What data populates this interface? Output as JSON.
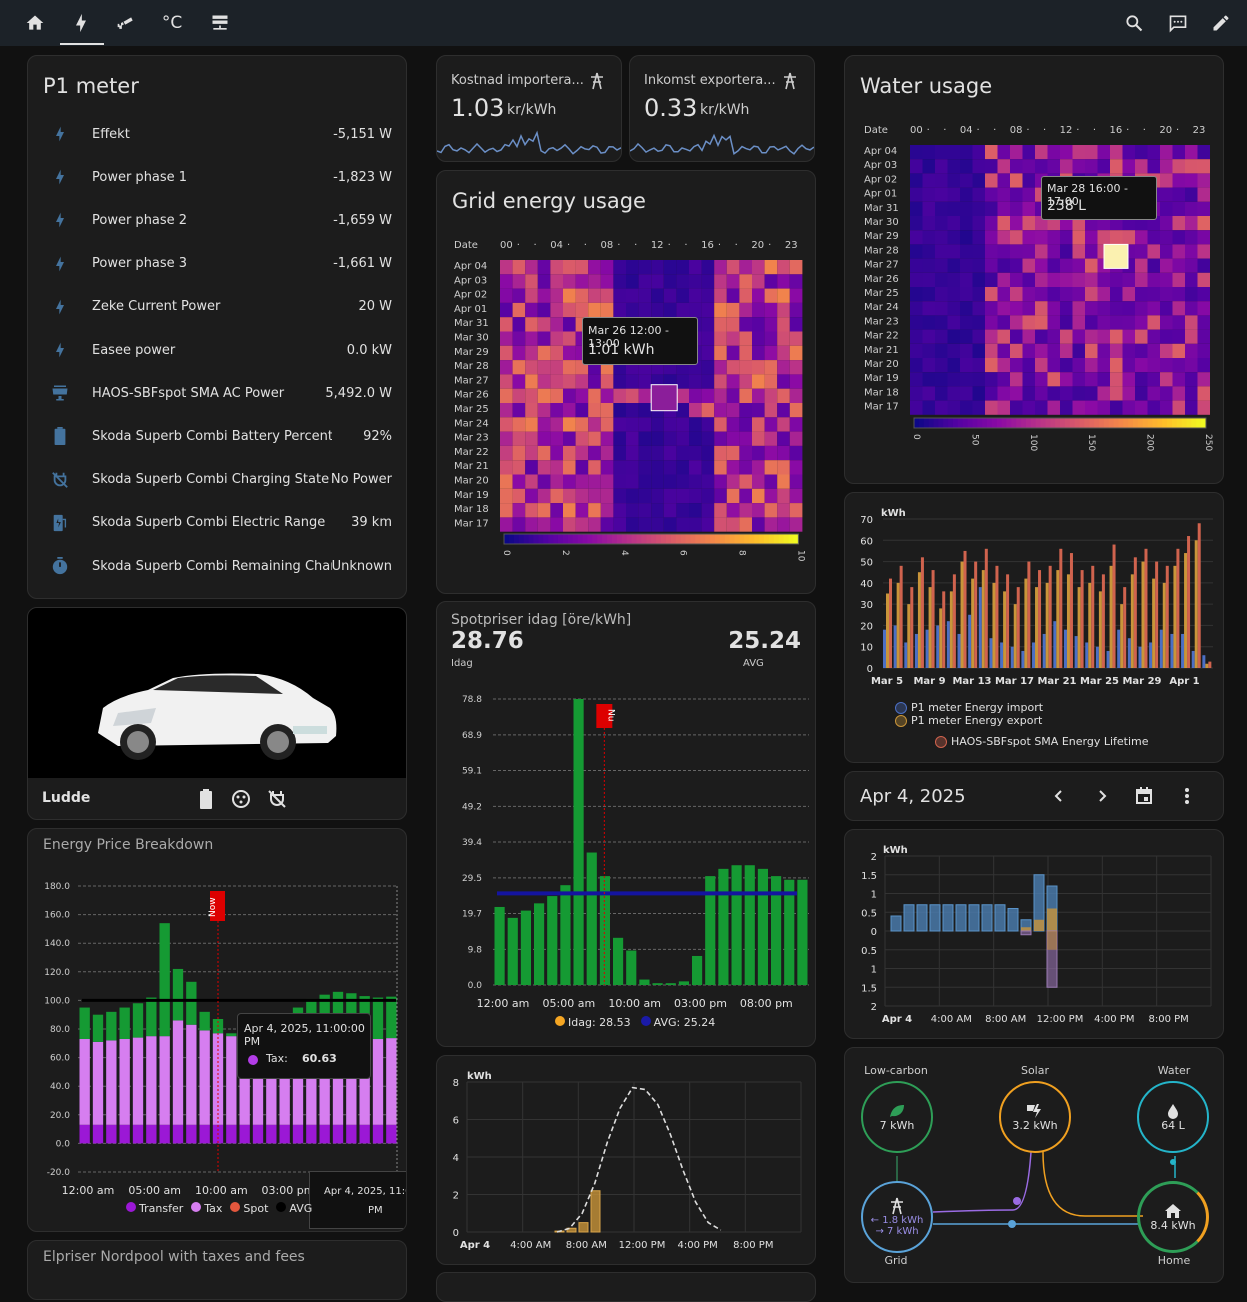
{
  "topbar": {
    "icons": [
      "home-icon",
      "lightning-icon",
      "cctv-icon",
      "thermometer-celsius-icon",
      "server-network-icon",
      "search-icon",
      "chat-icon",
      "pencil-icon"
    ],
    "temp_label": "°C"
  },
  "p1": {
    "title": "P1 meter",
    "rows": [
      {
        "name": "Effekt",
        "value": "-5,151 W",
        "icon": "lightning-icon"
      },
      {
        "name": "Power phase 1",
        "value": "-1,823 W",
        "icon": "lightning-icon"
      },
      {
        "name": "Power phase 2",
        "value": "-1,659 W",
        "icon": "lightning-icon"
      },
      {
        "name": "Power phase 3",
        "value": "-1,661 W",
        "icon": "lightning-icon"
      },
      {
        "name": "Zeke Current Power",
        "value": "20 W",
        "icon": "lightning-icon"
      },
      {
        "name": "Easee power",
        "value": "0.0 kW",
        "icon": "lightning-icon"
      },
      {
        "name": "HAOS-SBFspot SMA AC Power",
        "value": "5,492.0 W",
        "icon": "solar-panel-icon"
      },
      {
        "name": "Škoda Superb Combi Battery Percentage",
        "value": "92%",
        "icon": "battery-icon"
      },
      {
        "name": "Škoda Superb Combi Charging State",
        "value": "No Power",
        "icon": "power-plug-off-icon"
      },
      {
        "name": "Škoda Superb Combi Electric Range",
        "value": "39 km",
        "icon": "ev-station-icon"
      },
      {
        "name": "Škoda Superb Combi Remaining Chargin...",
        "value": "Unknown",
        "icon": "timer-icon"
      }
    ]
  },
  "car": {
    "name": "Ludde"
  },
  "import_cost": {
    "title": "Kostnad importera...",
    "value": "1.03",
    "unit": "kr/kWh"
  },
  "export_income": {
    "title": "Inkomst exportera...",
    "value": "0.33",
    "unit": "kr/kWh"
  },
  "grid_heat": {
    "title": "Grid energy usage",
    "date_label": "Date",
    "hour_labels": [
      "00",
      "·",
      "·",
      "04",
      "·",
      "·",
      "08",
      "·",
      "·",
      "12",
      "·",
      "·",
      "16",
      "·",
      "·",
      "20",
      "·",
      "23"
    ],
    "dates": [
      "Apr 04",
      "Apr 03",
      "Apr 02",
      "Apr 01",
      "Mar 31",
      "Mar 30",
      "Mar 29",
      "Mar 28",
      "Mar 27",
      "Mar 26",
      "Mar 25",
      "Mar 24",
      "Mar 23",
      "Mar 22",
      "Mar 21",
      "Mar 20",
      "Mar 19",
      "Mar 18",
      "Mar 17"
    ],
    "scale": [
      "0",
      "2",
      "4",
      "6",
      "8",
      "10"
    ],
    "tooltip_title": "Mar 26 12:00 - 13:00",
    "tooltip_value": "1.01 kWh"
  },
  "water_heat": {
    "title": "Water usage",
    "date_label": "Date",
    "hour_labels": [
      "00",
      "·",
      "·",
      "04",
      "·",
      "·",
      "08",
      "·",
      "·",
      "12",
      "·",
      "·",
      "16",
      "·",
      "·",
      "20",
      "·",
      "23"
    ],
    "dates": [
      "Apr 04",
      "Apr 03",
      "Apr 02",
      "Apr 01",
      "Mar 31",
      "Mar 30",
      "Mar 29",
      "Mar 28",
      "Mar 27",
      "Mar 26",
      "Mar 25",
      "Mar 24",
      "Mar 23",
      "Mar 22",
      "Mar 21",
      "Mar 20",
      "Mar 19",
      "Mar 18",
      "Mar 17"
    ],
    "scale": [
      "0",
      "50",
      "100",
      "150",
      "200",
      "250"
    ],
    "tooltip_title": "Mar 28 16:00 - 17:00",
    "tooltip_value": "238 L"
  },
  "spot": {
    "title": "Spotpriser idag [öre/kWh]",
    "today_value": "28.76",
    "today_label": "Idag",
    "avg_value": "25.24",
    "avg_label": "AVG",
    "now_label": "Nu",
    "legend": [
      {
        "name": "Idag: 28.53",
        "color": "#f5a623"
      },
      {
        "name": "AVG: 25.24",
        "color": "#1a1aa8"
      }
    ]
  },
  "price_breakdown": {
    "title": "Energy Price Breakdown",
    "now_label": "Now",
    "tooltip_title": "Apr 4, 2025, 11:00:00 PM",
    "tooltip_item": "Tax:",
    "tooltip_value": "60.63",
    "tooltip2_line1": "Apr 4, 2025, 11:0",
    "tooltip2_line2": "PM",
    "legend": [
      {
        "name": "Transfer",
        "color": "#9b18d6"
      },
      {
        "name": "Tax",
        "color": "#d67ef0"
      },
      {
        "name": "Spot",
        "color": "#e4573d"
      },
      {
        "name": "AVG",
        "color": "#000000"
      }
    ]
  },
  "nordpool": {
    "title": "Elpriser Nordpool with taxes and fees"
  },
  "monthly": {
    "unit": "kWh",
    "legend": [
      {
        "name": "P1 meter Energy import",
        "color": "#4c6fc4"
      },
      {
        "name": "P1 meter Energy export",
        "color": "#c9953a"
      },
      {
        "name": "HAOS-SBFspot SMA Energy Lifetime",
        "color": "#d0634e"
      }
    ]
  },
  "date_picker": {
    "label": "Apr 4, 2025"
  },
  "flow": {
    "low_carbon_label": "Low-carbon",
    "low_carbon_value": "7 kWh",
    "solar_label": "Solar",
    "solar_value": "3.2 kWh",
    "water_label": "Water",
    "water_value": "64 L",
    "grid_in": "← 1.8 kWh",
    "grid_out": "→ 7 kWh",
    "grid_label": "Grid",
    "home_value": "8.4 kWh",
    "home_label": "Home"
  },
  "chart_data": [
    {
      "type": "bar",
      "title": "Spotpriser idag [öre/kWh]",
      "categories": [
        "00",
        "01",
        "02",
        "03",
        "04",
        "05",
        "06",
        "07",
        "08",
        "09",
        "10",
        "11",
        "12",
        "13",
        "14",
        "15",
        "16",
        "17",
        "18",
        "19",
        "20",
        "21",
        "22",
        "23"
      ],
      "values": [
        21.5,
        18.5,
        20.5,
        22.5,
        24.5,
        27.5,
        78.8,
        36.5,
        30,
        13,
        9.5,
        1.5,
        0.5,
        0.5,
        1,
        8,
        30,
        32,
        33,
        33,
        32,
        30,
        29,
        29
      ],
      "yticks": [
        0.0,
        9.8,
        19.7,
        29.5,
        39.4,
        49.2,
        59.1,
        68.9,
        78.8
      ],
      "ylim": [
        0,
        78.8
      ],
      "avg": 25.24,
      "xtick_labels": [
        "12:00 am",
        "05:00 am",
        "10:00 am",
        "03:00 pm",
        "08:00 pm"
      ]
    },
    {
      "type": "bar",
      "title": "Energy Price Breakdown",
      "series": [
        {
          "name": "Transfer",
          "values": [
            13,
            13,
            13,
            13,
            13,
            13,
            13,
            13,
            13,
            13,
            13,
            13,
            13,
            13,
            13,
            13,
            13,
            13,
            13,
            13,
            13,
            13,
            13,
            13
          ]
        },
        {
          "name": "Tax",
          "values": [
            60,
            58,
            59,
            60,
            61,
            62,
            62,
            73,
            70,
            66,
            64,
            62,
            56,
            44,
            42,
            46,
            52,
            56,
            58,
            60,
            60,
            60,
            60,
            60.63
          ]
        },
        {
          "name": "Spot",
          "values": [
            22,
            19,
            20,
            22,
            24,
            27,
            79,
            36,
            30,
            13,
            10,
            2,
            1,
            1,
            1,
            8,
            30,
            32,
            33,
            33,
            32,
            30,
            29,
            29
          ]
        }
      ],
      "yticks": [
        -20,
        0,
        20,
        40,
        60,
        80,
        100,
        120,
        140,
        160,
        180
      ],
      "ylim": [
        -20,
        180
      ],
      "xtick_labels": [
        "12:00 am",
        "05:00 am",
        "10:00 am",
        "03:00 pm",
        "08:00 pm"
      ]
    },
    {
      "type": "bar",
      "title": "",
      "ylabel": "kWh",
      "yticks": [
        0,
        10,
        20,
        30,
        40,
        50,
        60,
        70
      ],
      "ylim": [
        0,
        70
      ],
      "xtick_labels": [
        "Mar 5",
        "Mar 9",
        "Mar 13",
        "Mar 17",
        "Mar 21",
        "Mar 25",
        "Mar 29",
        "Apr 1"
      ],
      "series": [
        {
          "name": "P1 meter Energy import",
          "values": [
            18,
            20,
            12,
            16,
            18,
            20,
            22,
            16,
            25,
            38,
            14,
            12,
            10,
            8,
            12,
            16,
            22,
            18,
            15,
            12,
            10,
            8,
            18,
            14,
            10,
            12,
            18,
            16,
            16,
            8,
            6
          ]
        },
        {
          "name": "P1 meter Energy export",
          "values": [
            35,
            40,
            30,
            45,
            38,
            28,
            36,
            50,
            42,
            46,
            40,
            36,
            30,
            42,
            38,
            40,
            46,
            44,
            38,
            40,
            36,
            48,
            30,
            44,
            50,
            42,
            40,
            48,
            54,
            60,
            2
          ]
        },
        {
          "name": "HAOS-SBFspot SMA Energy Lifetime",
          "values": [
            42,
            48,
            38,
            52,
            46,
            36,
            44,
            55,
            50,
            56,
            48,
            44,
            38,
            50,
            46,
            48,
            56,
            54,
            46,
            48,
            44,
            58,
            38,
            52,
            56,
            50,
            48,
            56,
            62,
            68,
            3
          ]
        }
      ]
    },
    {
      "type": "bar",
      "title": "",
      "ylabel": "kWh",
      "yticks": [
        "2",
        "1.5",
        "1",
        "0.5",
        "0",
        "0.5",
        "1",
        "1.5",
        "2"
      ],
      "ylim": [
        -2,
        2
      ],
      "xtick_labels": [
        "Apr 4",
        "4:00 AM",
        "8:00 AM",
        "12:00 PM",
        "4:00 PM",
        "8:00 PM"
      ],
      "series": [
        {
          "name": "import",
          "values": [
            0.4,
            0.7,
            0.7,
            0.7,
            0.7,
            0.7,
            0.7,
            0.7,
            0.7,
            0.6,
            0.3,
            1.5,
            1.2
          ]
        },
        {
          "name": "solar",
          "values": [
            0,
            0,
            0,
            0,
            0,
            0,
            0,
            0,
            0,
            0,
            0.1,
            0.3,
            0.6
          ]
        },
        {
          "name": "export",
          "values": [
            0,
            0,
            0,
            0,
            0,
            0,
            0,
            0,
            0,
            0,
            -0.1,
            0,
            -1.5
          ]
        }
      ]
    },
    {
      "type": "area",
      "title": "",
      "ylabel": "kWh",
      "yticks": [
        0,
        2,
        4,
        6,
        8
      ],
      "ylim": [
        0,
        8
      ],
      "xtick_labels": [
        "Apr 4",
        "4:00 AM",
        "8:00 AM",
        "12:00 PM",
        "4:00 PM",
        "8:00 PM"
      ],
      "series": [
        {
          "name": "solar actual",
          "values": [
            0.05,
            0.2,
            0.5,
            2.2
          ]
        },
        {
          "name": "forecast",
          "values": [
            0,
            0.2,
            1,
            2.6,
            4.8,
            6.6,
            7.7,
            7.6,
            6.8,
            5.2,
            3.3,
            1.6,
            0.5,
            0.1
          ]
        }
      ]
    }
  ]
}
